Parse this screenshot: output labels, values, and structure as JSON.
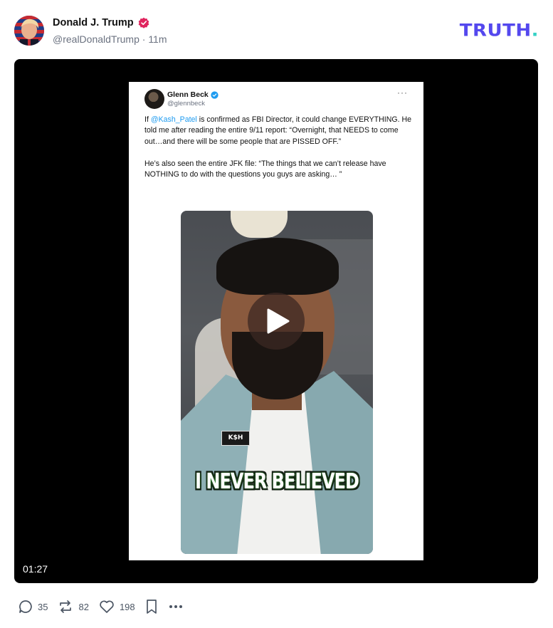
{
  "post": {
    "display_name": "Donald J. Trump",
    "handle": "@realDonaldTrump",
    "separator": "·",
    "time": "11m",
    "brand": "TRUTH",
    "brand_dot": ".",
    "colors": {
      "brand": "#5448ee",
      "brand_dot": "#35d1c5",
      "verified": "#e0245e"
    }
  },
  "embedded_tweet": {
    "name": "Glenn Beck",
    "handle": "@glennbeck",
    "more": "···",
    "text_part1": "If ",
    "mention": "@Kash_Patel",
    "text_part2": " is confirmed as FBI Director, it could change EVERYTHING. He told me after reading the entire 9/11 report: “Overnight, that NEEDS to come out…and there will be some people that are PISSED OFF.”\n\nHe’s also seen the entire JFK file: “The things that we can’t release have NOTHING to do with the questions you guys are asking… ”",
    "pin_text": "K$H",
    "caption": "I NEVER BELIEVED"
  },
  "video": {
    "duration": "01:27",
    "icon": "play-icon"
  },
  "actions": {
    "replies": "35",
    "reposts": "82",
    "likes": "198"
  }
}
